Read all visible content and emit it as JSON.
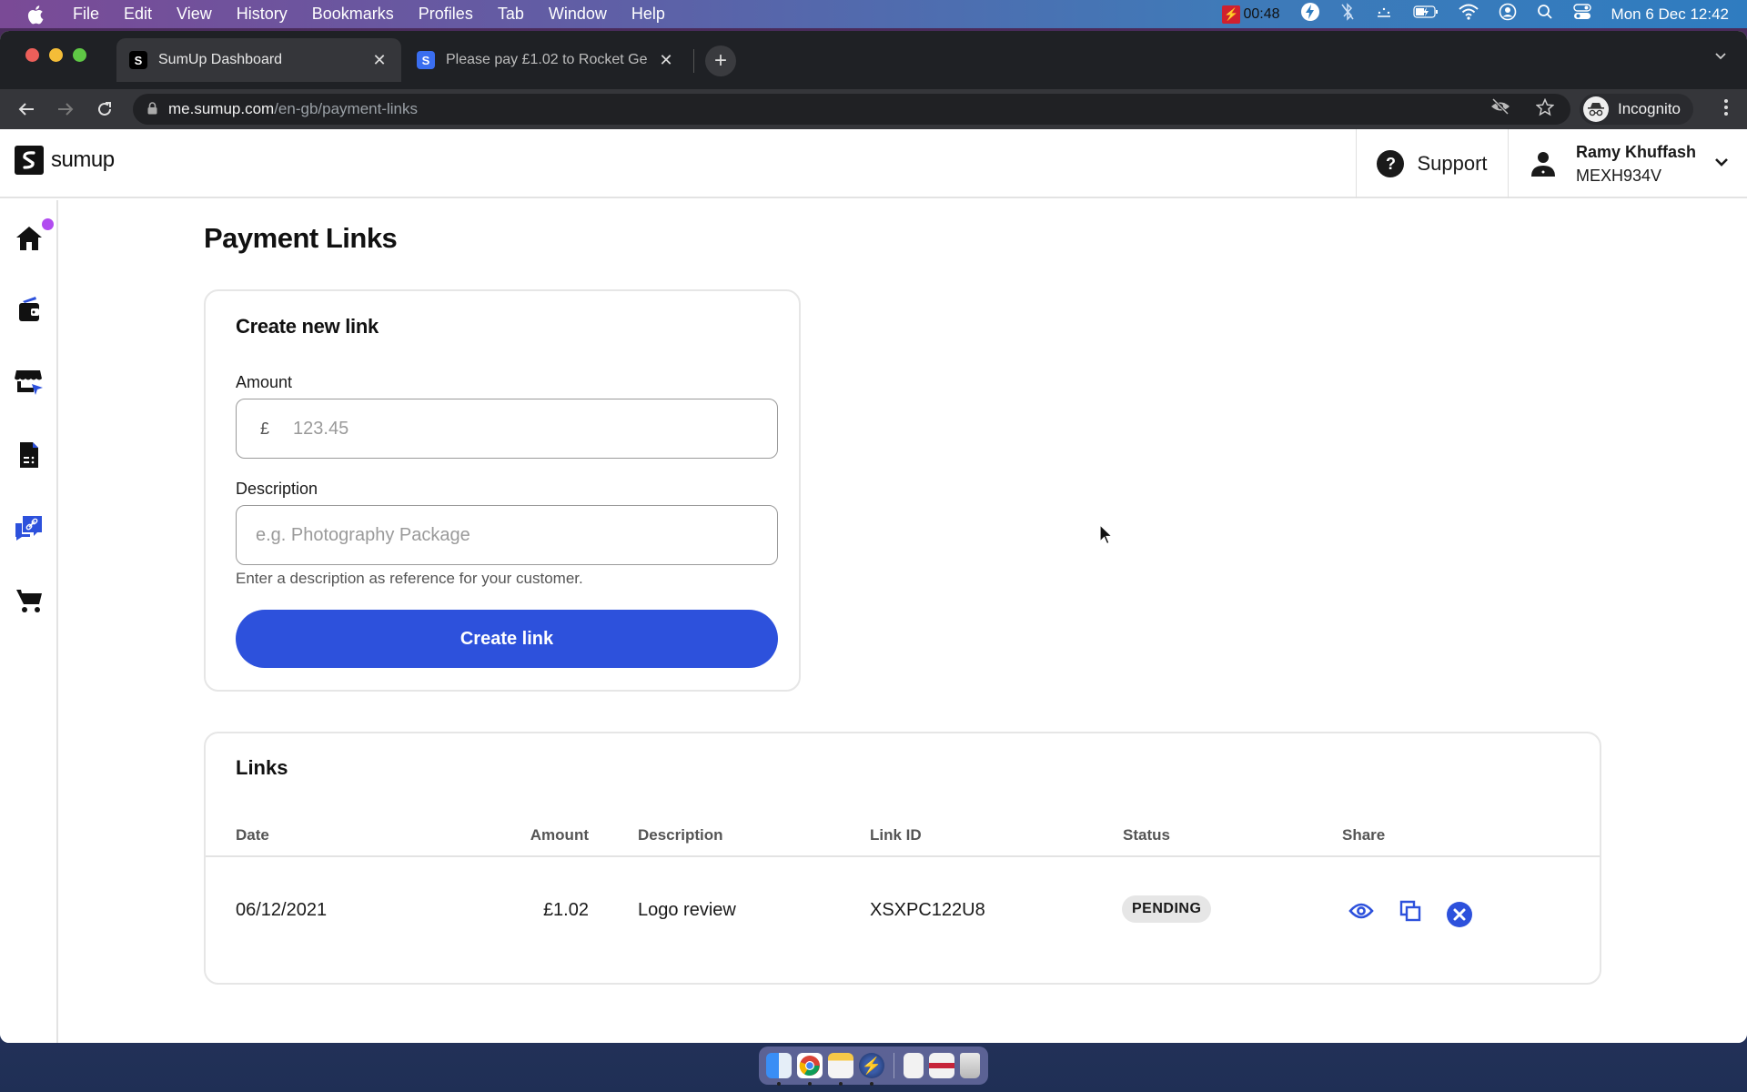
{
  "menubar": {
    "app_name": "Chrome",
    "items": [
      "File",
      "Edit",
      "View",
      "History",
      "Bookmarks",
      "Profiles",
      "Tab",
      "Window",
      "Help"
    ],
    "recording_time": "00:48",
    "datetime": "Mon 6 Dec  12:42"
  },
  "browser": {
    "tabs": [
      {
        "title": "SumUp Dashboard",
        "active": true
      },
      {
        "title": "Please pay £1.02 to Rocket Ge",
        "active": false
      }
    ],
    "url_host": "me.sumup.com",
    "url_path": "/en-gb/payment-links",
    "profile_label": "Incognito"
  },
  "app": {
    "brand": "sumup",
    "support_label": "Support",
    "user": {
      "name": "Ramy Khuffash",
      "merchant_id": "MEXH934V"
    },
    "sidebar": [
      {
        "icon": "home-icon",
        "has_notification": true
      },
      {
        "icon": "wallet-icon"
      },
      {
        "icon": "storefront-icon"
      },
      {
        "icon": "invoice-icon"
      },
      {
        "icon": "payment-link-icon",
        "active": true
      },
      {
        "icon": "cart-icon"
      }
    ],
    "colors": {
      "accent": "#2d51dc",
      "notification": "#b14cf0",
      "pill_bg": "#e6e6e6"
    }
  },
  "page": {
    "title": "Payment Links",
    "create": {
      "title": "Create new link",
      "amount_label": "Amount",
      "currency_symbol": "£",
      "amount_placeholder": "123.45",
      "description_label": "Description",
      "description_placeholder": "e.g. Photography Package",
      "helper_text": "Enter a description as reference for your customer.",
      "button_label": "Create link"
    },
    "links": {
      "title": "Links",
      "columns": [
        "Date",
        "Amount",
        "Description",
        "Link ID",
        "Status",
        "Share"
      ],
      "rows": [
        {
          "date": "06/12/2021",
          "amount": "£1.02",
          "description": "Logo review",
          "link_id": "XSXPC122U8",
          "status": "PENDING"
        }
      ]
    }
  }
}
